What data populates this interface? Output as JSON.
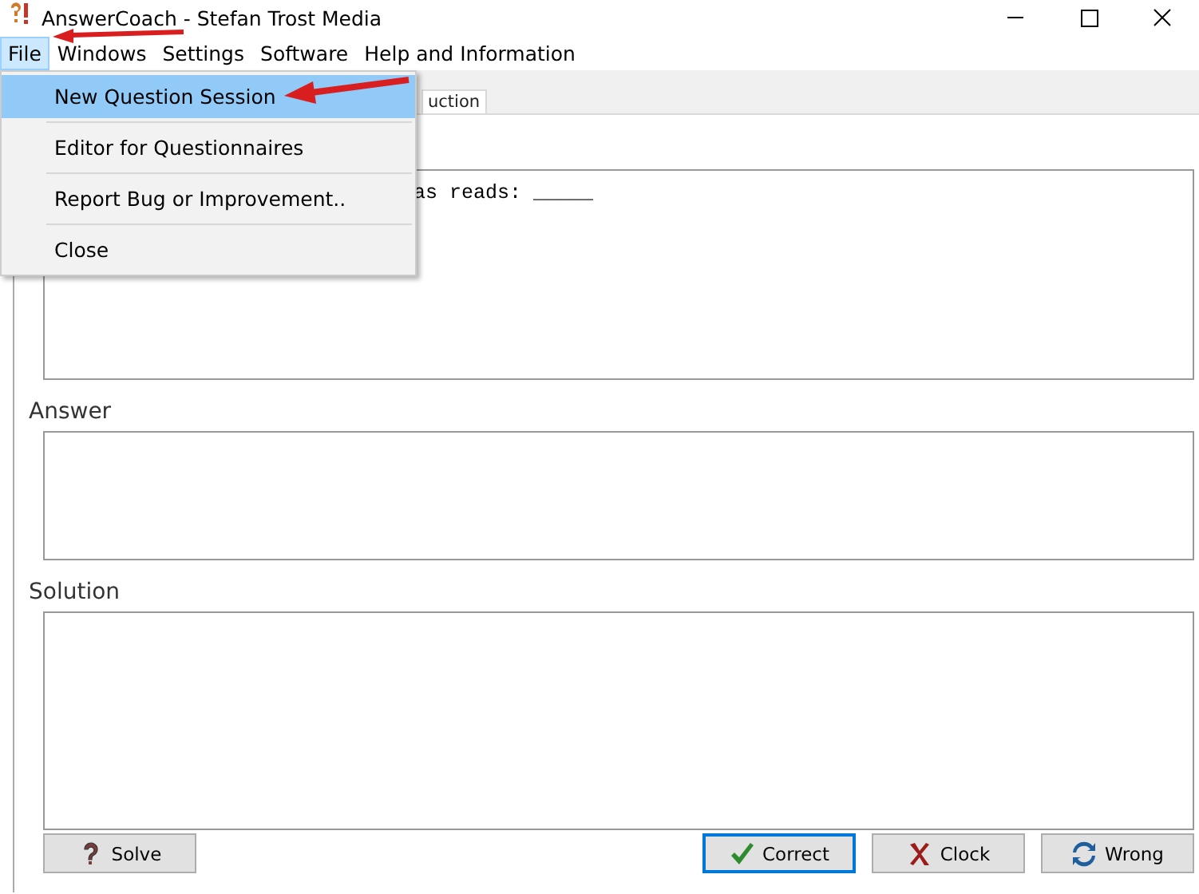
{
  "window": {
    "title": "AnswerCoach - Stefan Trost Media"
  },
  "menu_bar": [
    {
      "label": "File",
      "selected": true
    },
    {
      "label": "Windows",
      "selected": false
    },
    {
      "label": "Settings",
      "selected": false
    },
    {
      "label": "Software",
      "selected": false
    },
    {
      "label": "Help and Information",
      "selected": false
    }
  ],
  "file_menu": [
    {
      "label": "New Question Session",
      "selected": true
    },
    {
      "label": "Editor for Questionnaires",
      "selected": false
    },
    {
      "label": "Report Bug or Improvement..",
      "selected": false
    },
    {
      "label": "Close",
      "selected": false
    }
  ],
  "tab": {
    "label": "uction"
  },
  "question": {
    "value": "as reads: _____"
  },
  "answer": {
    "label": "Answer"
  },
  "solution": {
    "label": "Solution"
  },
  "buttons": [
    {
      "label": "Solve",
      "kind": "solve"
    },
    {
      "label": "Correct",
      "kind": "correct"
    },
    {
      "label": "Clock",
      "kind": "clock"
    },
    {
      "label": "Wrong",
      "kind": "wrong"
    }
  ]
}
